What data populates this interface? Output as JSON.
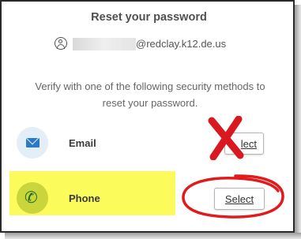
{
  "dialog": {
    "title": "Reset your password",
    "user": {
      "icon": "user-circle-icon",
      "email_domain": "@redclay.k12.de.us"
    },
    "description": "Verify with one of the following security methods to reset your password."
  },
  "methods": [
    {
      "label": "Email",
      "icon": "envelope-icon",
      "button_label": "lect",
      "button_full_label": "Select"
    },
    {
      "label": "Phone",
      "icon": "phone-icon",
      "button_label": "Select"
    }
  ],
  "annotations": {
    "x_mark_color": "#d9191f",
    "oval_color": "#e01b1b",
    "highlight_color": "#fcfb5c"
  }
}
